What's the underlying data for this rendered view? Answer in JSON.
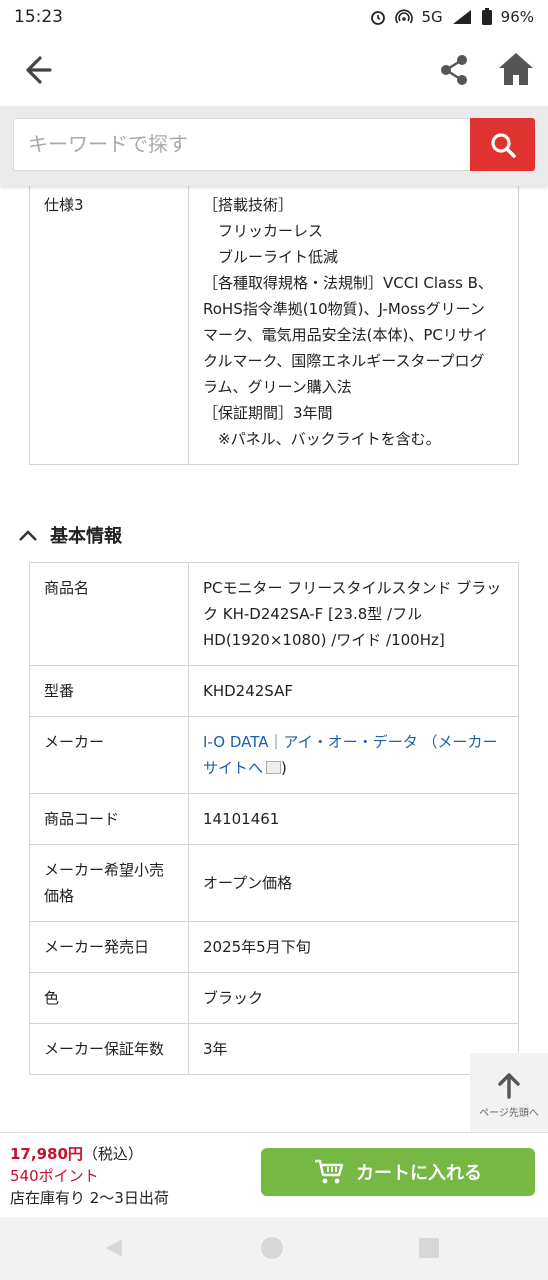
{
  "status": {
    "time": "15:23",
    "network": "5G",
    "battery": "96%"
  },
  "search": {
    "placeholder": "キーワードで探す"
  },
  "spec3": {
    "label": "仕様3",
    "lines": [
      "［搭載技術］",
      "　フリッカーレス",
      "　ブルーライト低減",
      "［各種取得規格・法規制］VCCI Class B、",
      "RoHS指令準拠(10物質)、J-Mossグリーン",
      "マーク、電気用品安全法(本体)、PCリサイ",
      "クルマーク、国際エネルギースタープログ",
      "ラム、グリーン購入法",
      "［保証期間］3年間",
      "　※パネル、バックライトを含む。"
    ]
  },
  "basic": {
    "title": "基本情報",
    "rows": [
      {
        "k": "商品名",
        "v": "PCモニター フリースタイルスタンド ブラック KH-D242SA-F [23.8型 /フルHD(1920×1080) /ワイド /100Hz]"
      },
      {
        "k": "型番",
        "v": "KHD242SAF"
      },
      {
        "k": "メーカー",
        "link": "I-O DATA｜アイ・オー・データ",
        "link2": "（メーカーサイトへ",
        "tail": ")"
      },
      {
        "k": "商品コード",
        "v": "14101461"
      },
      {
        "k": "メーカー希望小売価格",
        "v": "オープン価格"
      },
      {
        "k": "メーカー発売日",
        "v": "2025年5月下旬"
      },
      {
        "k": "色",
        "v": "ブラック"
      },
      {
        "k": "メーカー保証年数",
        "v": "3年"
      }
    ]
  },
  "totop": {
    "label": "ページ先頭へ"
  },
  "buy": {
    "price": "17,980円",
    "tax": "（税込）",
    "points": "540ポイント",
    "stock": "店在庫有り 2〜3日出荷",
    "cart": "カートに入れる"
  }
}
